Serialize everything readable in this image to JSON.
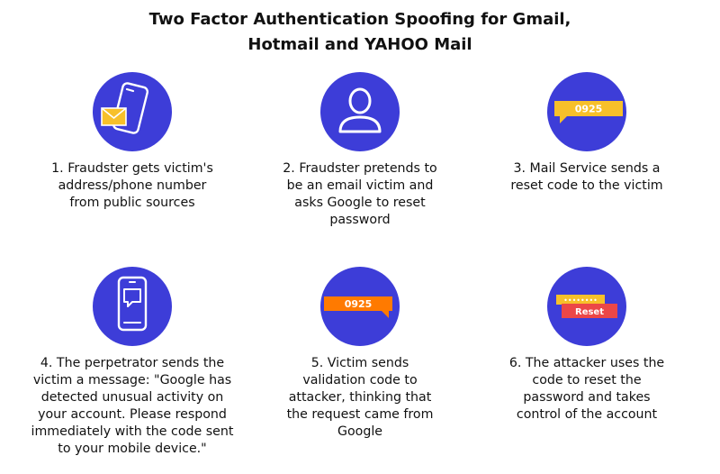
{
  "title": {
    "line1": "Two Factor Authentication Spoofing for Gmail,",
    "line2": "Hotmail and YAHOO Mail"
  },
  "colors": {
    "circle": "#3d3dd8",
    "yellow": "#f7c02a",
    "orange": "#ff7a00",
    "red": "#ec4747",
    "white": "#ffffff"
  },
  "steps": [
    {
      "icon": "phone-with-envelope-icon",
      "caption": [
        "1. Fraudster gets victim's",
        "address/phone number",
        "from public sources"
      ]
    },
    {
      "icon": "user-profile-icon",
      "caption": [
        "2. Fraudster pretends to",
        "be an email victim and",
        "asks Google to reset",
        "password"
      ]
    },
    {
      "icon": "code-message-icon",
      "code": "0925",
      "caption": [
        "3. Mail Service sends a",
        "reset code to the victim"
      ]
    },
    {
      "icon": "phone-with-chat-icon",
      "caption": [
        "4. The perpetrator sends the",
        "victim a message: \"Google has",
        "detected unusual activity on",
        "your account. Please respond",
        "immediately with the code sent",
        "to your mobile device.\""
      ]
    },
    {
      "icon": "code-message-icon",
      "code": "0925",
      "caption": [
        "5. Victim sends",
        "validation code to",
        "attacker, thinking that",
        "the request came from",
        "Google"
      ]
    },
    {
      "icon": "password-reset-icon",
      "masked": "••••••••",
      "button": "Reset",
      "caption": [
        "6. The attacker uses the",
        "code to reset the",
        "password and takes",
        "control of the account"
      ]
    }
  ]
}
